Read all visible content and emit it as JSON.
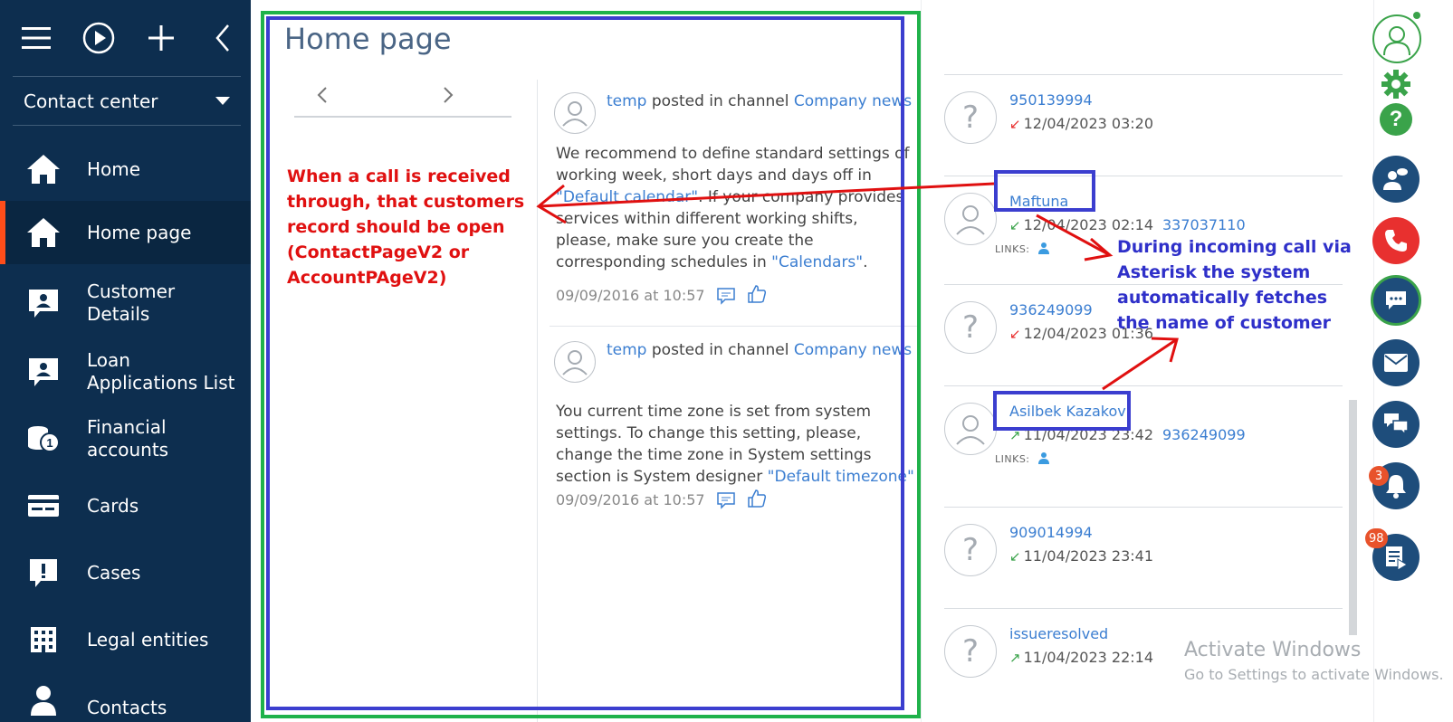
{
  "sidebar": {
    "workspace": "Contact center",
    "items": [
      {
        "label": "Home",
        "icon": "home-icon"
      },
      {
        "label": "Home page",
        "icon": "home-icon",
        "active": true
      },
      {
        "label": "Customer\nDetails",
        "icon": "id-card-icon"
      },
      {
        "label": "Loan\nApplications List",
        "icon": "id-card-icon"
      },
      {
        "label": "Financial\naccounts",
        "icon": "coins-icon"
      },
      {
        "label": "Cards",
        "icon": "card-icon"
      },
      {
        "label": "Cases",
        "icon": "exclamation-icon"
      },
      {
        "label": "Legal entities",
        "icon": "building-icon"
      },
      {
        "label": "Contacts",
        "icon": "person-icon"
      }
    ]
  },
  "main": {
    "title": "Home page",
    "posts": [
      {
        "author": "temp",
        "action": "posted in channel",
        "channel": "Company news",
        "body_before": "We recommend to define standard settings of working week, short days and days off in ",
        "body_link1": "\"Default calendar\"",
        "body_middle": ". If your company provides services within different working shifts, please, make sure you create the corresponding schedules in ",
        "body_link2": "\"Calendars\"",
        "body_after": ".",
        "date": "09/09/2016 at 10:57"
      },
      {
        "author": "temp",
        "action": "posted in channel",
        "channel": "Company news",
        "body_before": "You current time zone is set from system settings. To change this setting, please, change the time zone in System settings section is System designer ",
        "body_link1": "\"Default timezone\"",
        "body_middle": "",
        "body_link2": "",
        "body_after": "",
        "date": "09/09/2016 at 10:57"
      }
    ]
  },
  "calls": {
    "items": [
      {
        "name": "950139994",
        "direction": "missed",
        "datetime": "12/04/2023 03:20",
        "number": "",
        "links": false,
        "avatar": "?"
      },
      {
        "name": "Maftuna",
        "direction": "incoming",
        "datetime": "12/04/2023 02:14",
        "number": "337037110",
        "links": true,
        "avatar": "person"
      },
      {
        "name": "936249099",
        "direction": "missed",
        "datetime": "12/04/2023 01:36",
        "number": "",
        "links": false,
        "avatar": "?"
      },
      {
        "name": "Asilbek Kazakov",
        "direction": "outgoing",
        "datetime": "11/04/2023 23:42",
        "number": "936249099",
        "links": true,
        "avatar": "person"
      },
      {
        "name": "909014994",
        "direction": "incoming",
        "datetime": "11/04/2023 23:41",
        "number": "",
        "links": false,
        "avatar": "?"
      },
      {
        "name": "issueresolved",
        "direction": "outgoing",
        "datetime": "11/04/2023 22:14",
        "number": "",
        "links": false,
        "avatar": "?"
      }
    ],
    "links_label": "LINKS:"
  },
  "rightbar": {
    "notifications_count": "3",
    "feed_count": "98"
  },
  "annotations": {
    "red_note": "When a call is received\nthrough, that customers\nrecord should be open\n(ContactPageV2 or\nAccountPAgeV2)",
    "blue_note": "During incoming call via\nAsterisk the system\nautomatically fetches\nthe name of customer"
  },
  "watermark": {
    "title": "Activate Windows",
    "subtitle": "Go to Settings to activate Windows."
  },
  "colors": {
    "sidebar_bg": "#0d2e4f",
    "accent": "#ff4d1a",
    "link": "#3b7ed1",
    "rightbar_btn": "#1e4d7b",
    "phone_btn": "#e8302f",
    "annot_red": "#e01010",
    "annot_blue": "#2f30c9",
    "frame_green": "#1fb24a"
  }
}
